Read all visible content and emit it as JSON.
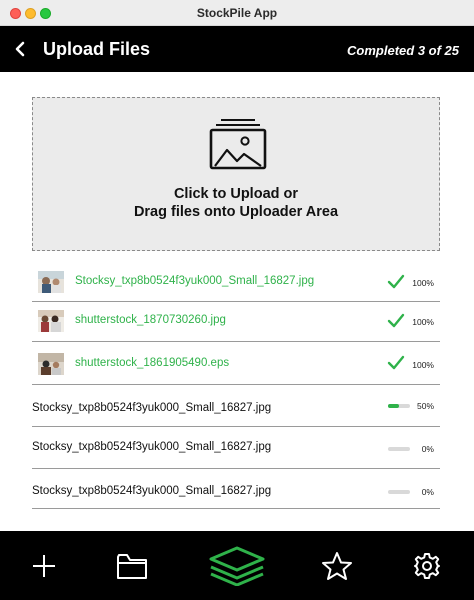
{
  "window": {
    "app_title": "StockPile App"
  },
  "header": {
    "title": "Upload Files",
    "status": "Completed 3 of 25"
  },
  "dropzone": {
    "line1": "Click to Upload or",
    "line2": "Drag files onto Uploader Area"
  },
  "colors": {
    "accent": "#2fb24a",
    "header_bg": "#000000",
    "dropzone_bg": "#ebebeb"
  },
  "files": [
    {
      "name": "Stocksy_txp8b0524f3yuk000_Small_16827.jpg",
      "progress": "100%",
      "progress_fraction": 1.0,
      "state": "done",
      "has_thumbnail": true
    },
    {
      "name": "shutterstock_1870730260.jpg",
      "progress": "100%",
      "progress_fraction": 1.0,
      "state": "done",
      "has_thumbnail": true
    },
    {
      "name": "shutterstock_1861905490.eps",
      "progress": "100%",
      "progress_fraction": 1.0,
      "state": "done",
      "has_thumbnail": true
    },
    {
      "name": "Stocksy_txp8b0524f3yuk000_Small_16827.jpg",
      "progress": "50%",
      "progress_fraction": 0.5,
      "state": "uploading",
      "has_thumbnail": false
    },
    {
      "name": "Stocksy_txp8b0524f3yuk000_Small_16827.jpg",
      "progress": "0%",
      "progress_fraction": 0.0,
      "state": "queued",
      "has_thumbnail": false
    },
    {
      "name": "Stocksy_txp8b0524f3yuk000_Small_16827.jpg",
      "progress": "0%",
      "progress_fraction": 0.0,
      "state": "queued",
      "has_thumbnail": false
    }
  ],
  "nav": {
    "items": [
      {
        "icon": "plus-icon",
        "active": false
      },
      {
        "icon": "folder-icon",
        "active": false
      },
      {
        "icon": "layers-icon",
        "active": true
      },
      {
        "icon": "star-icon",
        "active": false
      },
      {
        "icon": "gear-icon",
        "active": false
      }
    ]
  }
}
